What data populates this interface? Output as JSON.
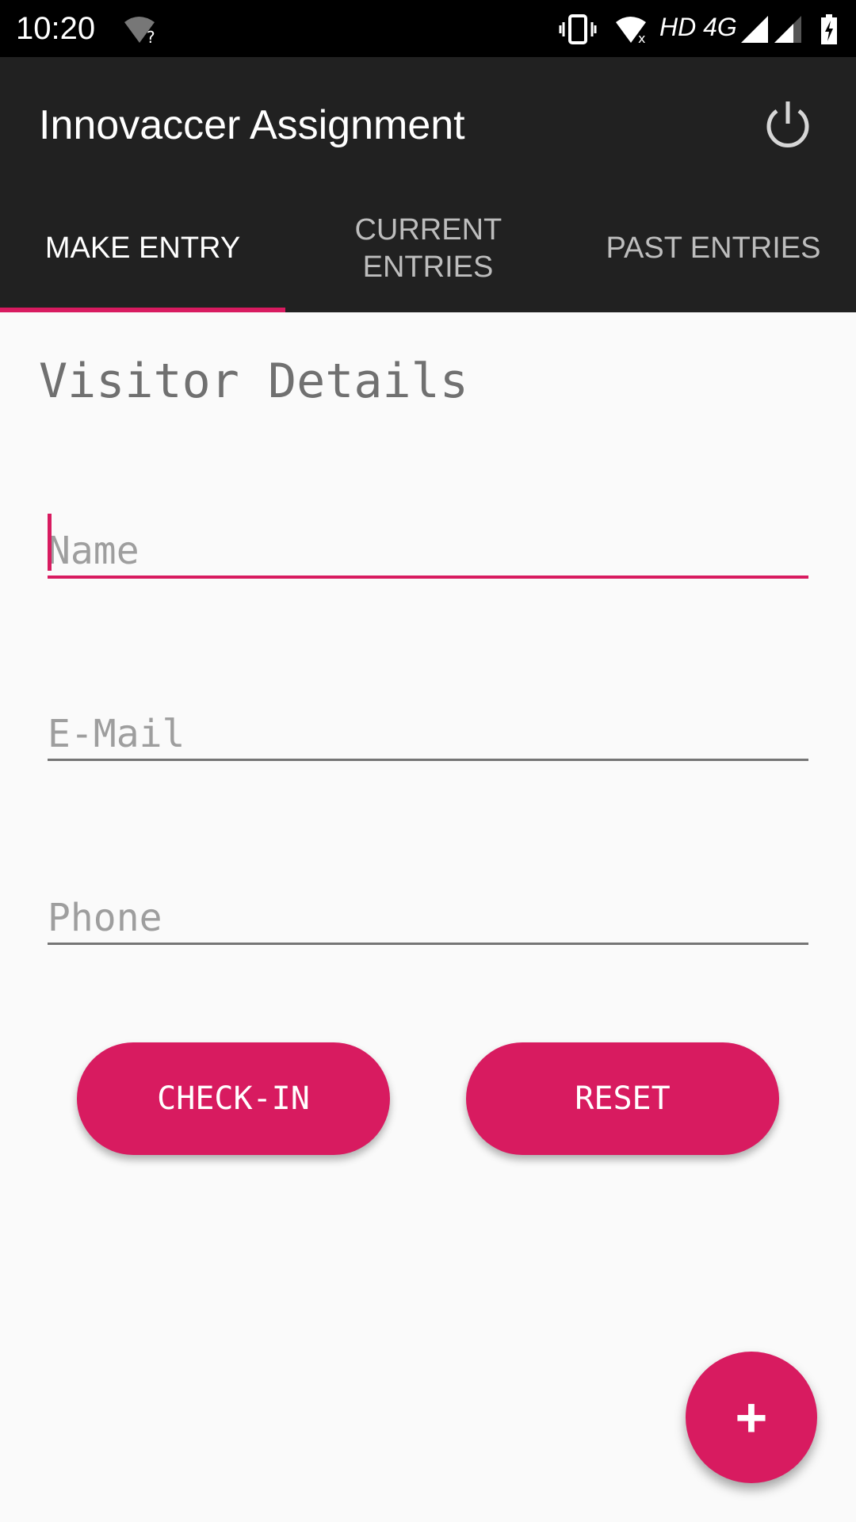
{
  "status_bar": {
    "time": "10:20",
    "network": "HD 4G"
  },
  "app_bar": {
    "title": "Innovaccer Assignment",
    "power_icon": "power-icon"
  },
  "tabs": [
    {
      "label": "MAKE ENTRY",
      "active": true
    },
    {
      "label": "CURRENT ENTRIES",
      "active": false
    },
    {
      "label": "PAST ENTRIES",
      "active": false
    }
  ],
  "form": {
    "heading": "Visitor Details",
    "name_placeholder": "Name",
    "email_placeholder": "E-Mail",
    "phone_placeholder": "Phone",
    "checkin_label": "CHECK-IN",
    "reset_label": "RESET"
  },
  "fab": {
    "label": "+"
  },
  "colors": {
    "accent": "#d81b60",
    "toolbar": "#212121"
  }
}
